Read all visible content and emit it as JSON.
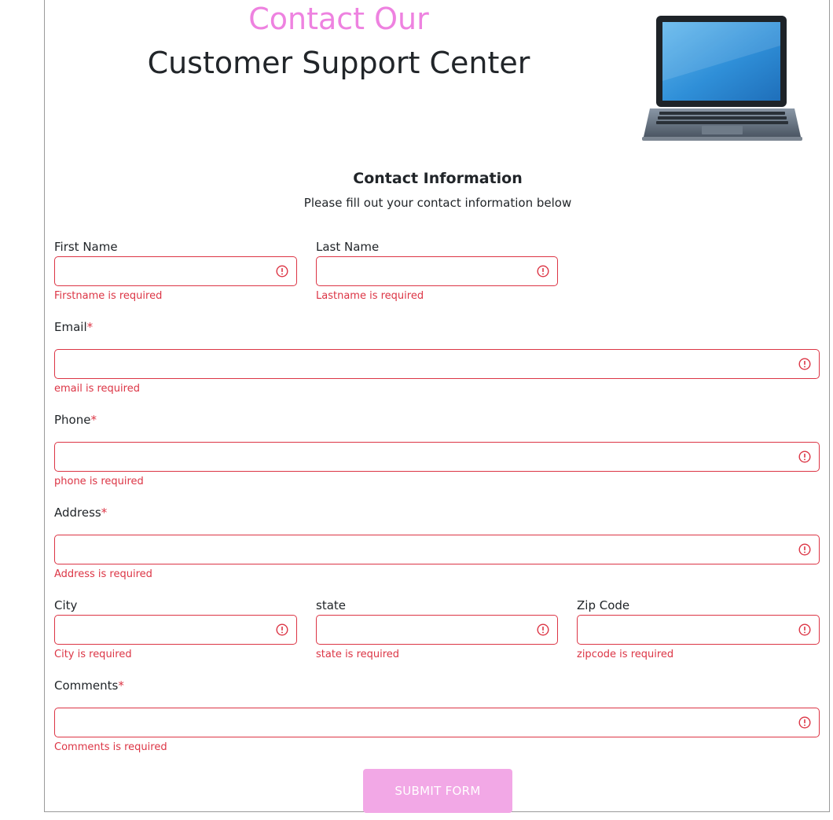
{
  "header": {
    "title_accent": "Contact Our",
    "title_main": "Customer Support Center"
  },
  "section": {
    "title": "Contact Information",
    "subtitle": "Please fill out your contact information below"
  },
  "form": {
    "first_name": {
      "label": "First Name",
      "value": "",
      "error": "Firstname is required"
    },
    "last_name": {
      "label": "Last Name",
      "value": "",
      "error": "Lastname is required"
    },
    "email": {
      "label": "Email",
      "required_mark": "*",
      "value": "",
      "error": "email is required"
    },
    "phone": {
      "label": "Phone",
      "required_mark": "*",
      "value": "",
      "error": "phone is required"
    },
    "address": {
      "label": "Address",
      "required_mark": "*",
      "value": "",
      "error": "Address is required"
    },
    "city": {
      "label": "City",
      "value": "",
      "error": "City is required"
    },
    "state": {
      "label": "state",
      "value": "",
      "error": "state is required"
    },
    "zip": {
      "label": "Zip Code",
      "value": "",
      "error": "zipcode is required"
    },
    "comments": {
      "label": "Comments",
      "required_mark": "*",
      "value": "",
      "error": "Comments is required"
    },
    "submit_label": "SUBMIT FORM"
  },
  "colors": {
    "accent": "#ee82e0",
    "error": "#dc3545",
    "submit_bg": "#f2a8e6"
  },
  "icons": {
    "field_error": "exclamation-circle-icon",
    "hero": "laptop-icon"
  }
}
